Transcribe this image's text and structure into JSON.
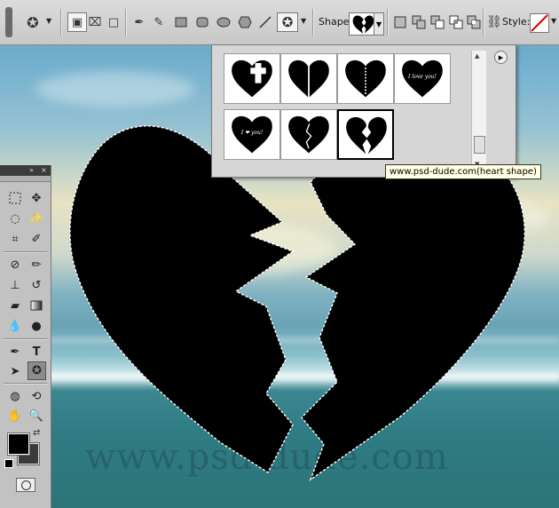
{
  "options_bar": {
    "shape_label": "Shape:",
    "style_label": "Style:",
    "selected_tool": "custom-shape"
  },
  "shape_picker": {
    "shapes": [
      {
        "name": "heart-cross-shape",
        "text": ""
      },
      {
        "name": "heart-split-shape",
        "text": ""
      },
      {
        "name": "heart-zipper-shape",
        "text": ""
      },
      {
        "name": "heart-i-love-you-shape",
        "text": "I love you!"
      },
      {
        "name": "heart-i-heart-you-shape",
        "text": "I ❤ you!"
      },
      {
        "name": "heart-crack-shape",
        "text": ""
      },
      {
        "name": "broken-heart-shape",
        "text": ""
      }
    ],
    "selected_index": 6,
    "tooltip": "www.psd-dude.com(heart shape)"
  },
  "canvas": {
    "watermark": "www.psd-dude.com"
  },
  "tools_panel": {
    "foreground_color": "#000000",
    "background_color": "#3a3a3a"
  }
}
